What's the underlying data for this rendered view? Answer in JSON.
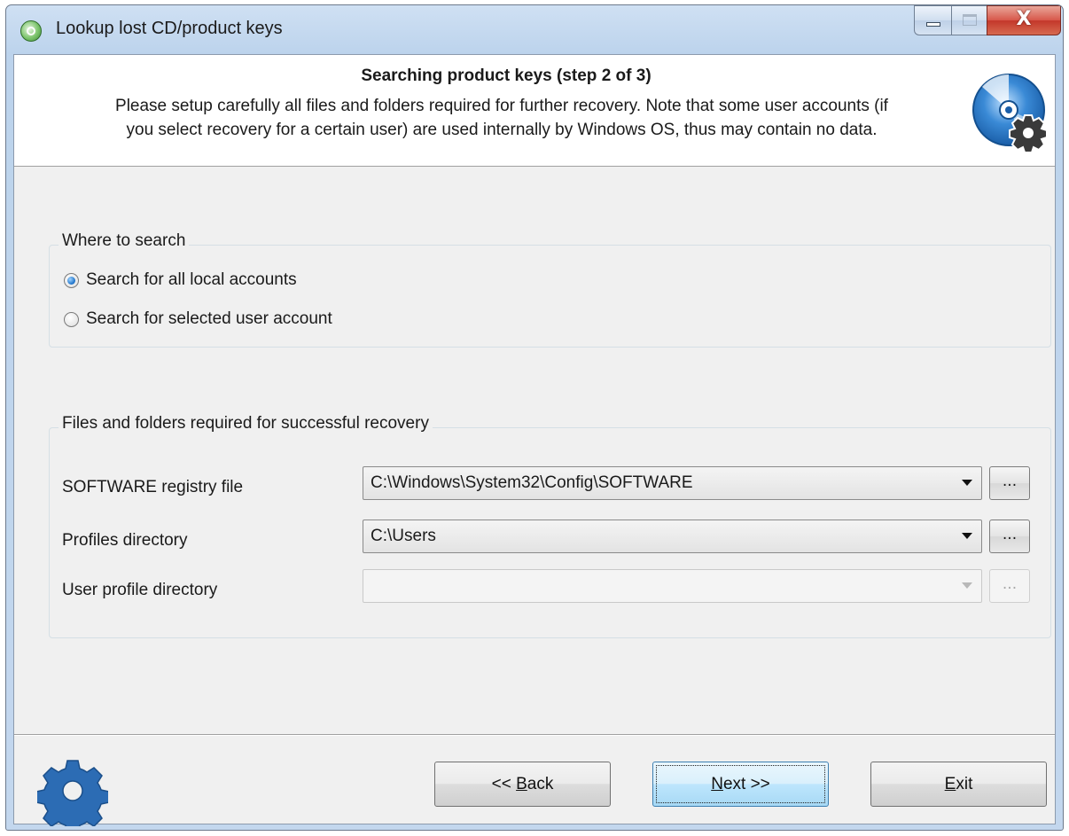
{
  "window": {
    "title": "Lookup lost CD/product keys",
    "close_glyph": "X"
  },
  "header": {
    "title": "Searching product keys (step 2 of 3)",
    "description_line1": "Please setup carefully all files and folders required for further recovery. Note that some user accounts (if",
    "description_line2": "you select recovery for a certain user) are used internally by Windows OS, thus may contain no data."
  },
  "where_to_search": {
    "label": "Where to search",
    "options": [
      {
        "label": "Search for all local accounts",
        "checked": true
      },
      {
        "label": "Search for selected user account",
        "checked": false
      }
    ]
  },
  "files_group": {
    "label": "Files and folders required for successful recovery",
    "fields": [
      {
        "label": "SOFTWARE registry file",
        "value": "C:\\Windows\\System32\\Config\\SOFTWARE",
        "browse": "...",
        "enabled": true
      },
      {
        "label": "Profiles directory",
        "value": "C:\\Users",
        "browse": "...",
        "enabled": true
      },
      {
        "label": "User profile directory",
        "value": "",
        "browse": "...",
        "enabled": false
      }
    ]
  },
  "buttons": {
    "back": {
      "prefix": "<< ",
      "accel": "B",
      "rest": "ack"
    },
    "next": {
      "accel": "N",
      "rest": "ext >>"
    },
    "exit": {
      "accel": "E",
      "rest": "xit"
    }
  },
  "colors": {
    "accent_blue": "#1a6fc7",
    "gear_blue": "#2c6cb4",
    "gear_dark": "#3a3a3a"
  }
}
